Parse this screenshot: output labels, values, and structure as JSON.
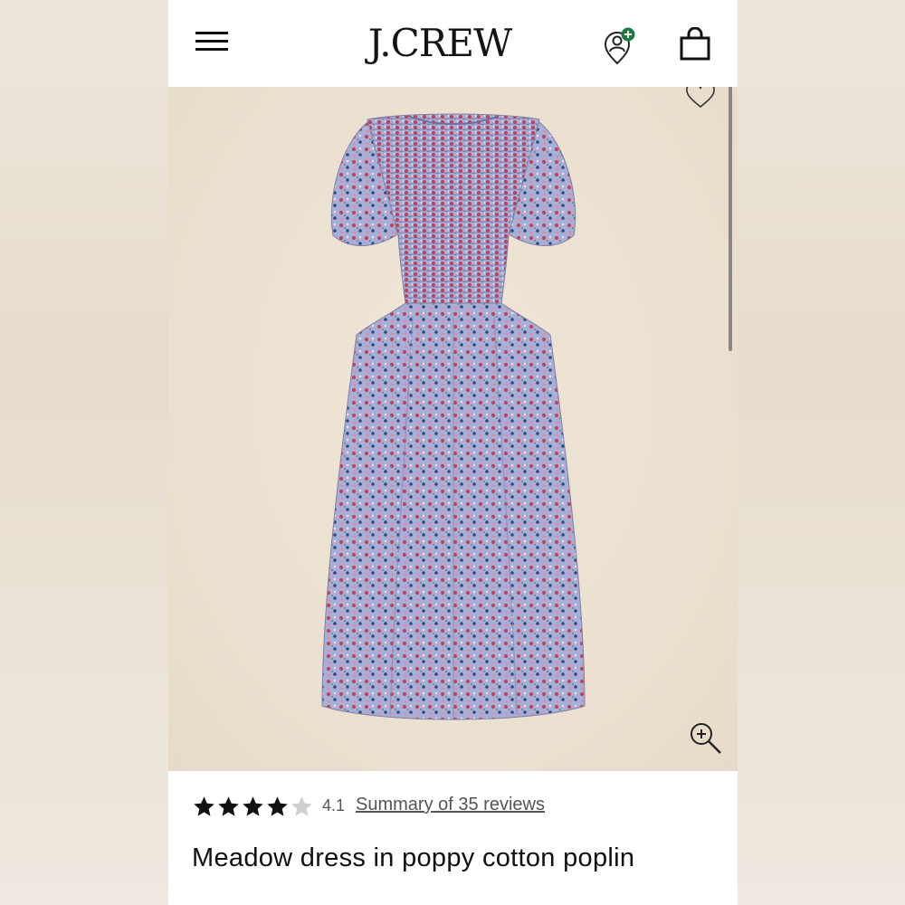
{
  "header": {
    "brand": "J.CREW",
    "menu_icon": "hamburger-menu-icon",
    "account_icon": "account-add-icon",
    "bag_icon": "shopping-bag-icon",
    "accent_color": "#1f7a3f"
  },
  "gallery": {
    "wishlist_icon": "heart-outline-icon",
    "zoom_icon": "zoom-in-icon",
    "image_subject": "floral print midi dress",
    "background_color": "#ebe0cf"
  },
  "rating": {
    "stars_filled": 4,
    "stars_total": 5,
    "value": "4.1",
    "reviews_link": "Summary of 35 reviews"
  },
  "product": {
    "title": "Meadow dress in poppy cotton poplin"
  }
}
